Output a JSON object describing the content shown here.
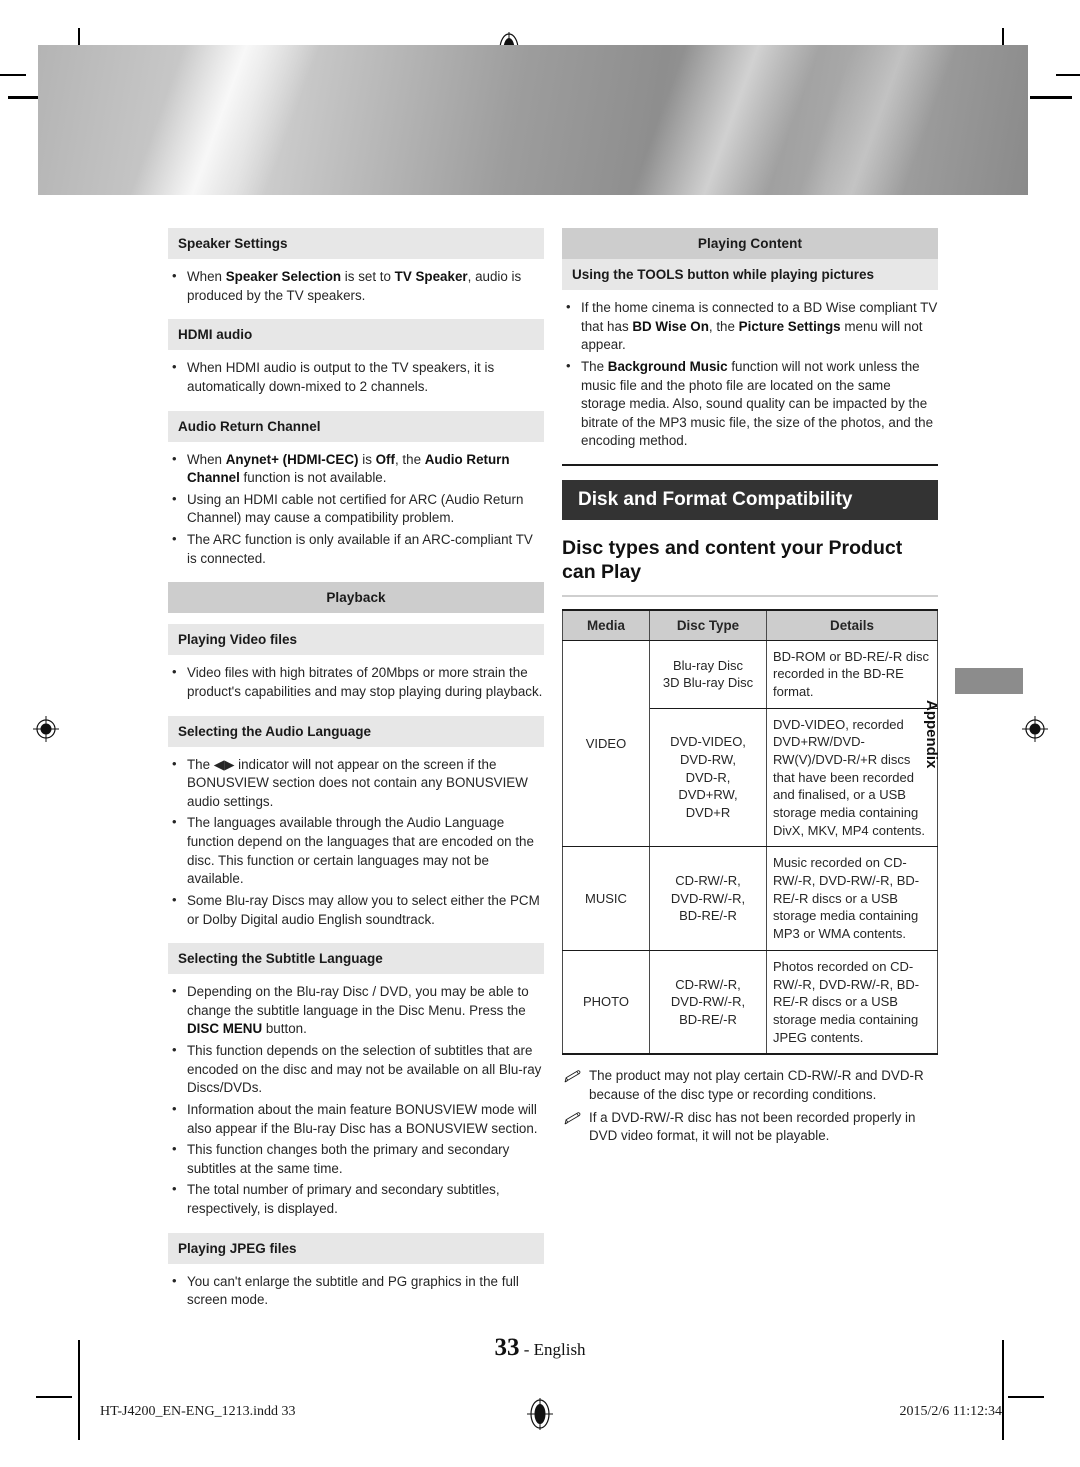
{
  "document": {
    "page_number": "33",
    "language": "English",
    "section_tab": "Appendix",
    "footer_file": "HT-J4200_EN-ENG_1213.indd   33",
    "footer_timestamp": "2015/2/6   11:12:34"
  },
  "colors": {
    "section_header_bg": "#cdcdcd",
    "sub_header_bg": "#e7e7e7",
    "dark_banner_bg": "#333333",
    "dark_banner_text": "#ffffff",
    "tab_bg": "#8c8c8c",
    "body_text": "#262626"
  },
  "left_column": {
    "blocks": [
      {
        "kind": "sub_header",
        "title": "Speaker Settings",
        "bullets": [
          [
            {
              "t": "When "
            },
            {
              "t": "Speaker Selection",
              "b": true
            },
            {
              "t": " is set to "
            },
            {
              "t": "TV Speaker",
              "b": true
            },
            {
              "t": ", audio is produced by the TV speakers."
            }
          ]
        ]
      },
      {
        "kind": "sub_header",
        "title": "HDMI audio",
        "bullets": [
          [
            {
              "t": "When HDMI audio is output to the TV speakers, it is automatically down-mixed to 2 channels."
            }
          ]
        ]
      },
      {
        "kind": "sub_header",
        "title": "Audio Return Channel",
        "bullets": [
          [
            {
              "t": "When "
            },
            {
              "t": "Anynet+ (HDMI-CEC)",
              "b": true
            },
            {
              "t": " is "
            },
            {
              "t": "Off",
              "b": true
            },
            {
              "t": ", the "
            },
            {
              "t": "Audio Return Channel",
              "b": true
            },
            {
              "t": " function is not available."
            }
          ],
          [
            {
              "t": "Using an HDMI cable not certified for ARC (Audio Return Channel) may cause a compatibility problem."
            }
          ],
          [
            {
              "t": "The ARC function is only available if an ARC-compliant TV is connected."
            }
          ]
        ]
      },
      {
        "kind": "section_header",
        "title": "Playback",
        "bullets": []
      },
      {
        "kind": "sub_header",
        "title": "Playing Video files",
        "bullets": [
          [
            {
              "t": "Video files with high bitrates of 20Mbps or more strain the product's capabilities and may stop playing during playback."
            }
          ]
        ]
      },
      {
        "kind": "sub_header",
        "title": "Selecting the Audio Language",
        "bullets": [
          [
            {
              "t": "The ◀▶ indicator will not appear on the screen if the BONUSVIEW section does not contain any BONUSVIEW audio settings."
            }
          ],
          [
            {
              "t": "The languages available through the Audio Language function depend on the languages that are encoded on the disc. This function or certain languages may not be available."
            }
          ],
          [
            {
              "t": "Some Blu-ray Discs may allow you to select either the PCM or Dolby Digital audio English soundtrack."
            }
          ]
        ]
      },
      {
        "kind": "sub_header",
        "title": "Selecting the Subtitle Language",
        "bullets": [
          [
            {
              "t": "Depending on the Blu-ray Disc / DVD, you may be able to change the subtitle language in the Disc Menu. Press the "
            },
            {
              "t": "DISC MENU",
              "b": true
            },
            {
              "t": " button."
            }
          ],
          [
            {
              "t": "This function depends on the selection of subtitles that are encoded on the disc and may not be available on all Blu-ray Discs/DVDs."
            }
          ],
          [
            {
              "t": "Information about the main feature BONUSVIEW mode will also appear if the Blu-ray Disc has a BONUSVIEW section."
            }
          ],
          [
            {
              "t": "This function changes both the primary and secondary subtitles at the same time."
            }
          ],
          [
            {
              "t": "The total number of primary and secondary subtitles, respectively, is displayed."
            }
          ]
        ]
      },
      {
        "kind": "sub_header",
        "title": "Playing JPEG files",
        "bullets": [
          [
            {
              "t": "You can't enlarge the subtitle and PG graphics in the full screen mode."
            }
          ]
        ]
      }
    ]
  },
  "right_column": {
    "playing_content": {
      "section_header": "Playing Content",
      "sub_header": "Using the TOOLS button while playing pictures",
      "bullets": [
        [
          {
            "t": "If the home cinema is connected to a BD Wise compliant TV that has "
          },
          {
            "t": "BD Wise On",
            "b": true
          },
          {
            "t": ", the "
          },
          {
            "t": "Picture Settings",
            "b": true
          },
          {
            "t": " menu will not appear."
          }
        ],
        [
          {
            "t": "The "
          },
          {
            "t": "Background Music",
            "b": true
          },
          {
            "t": " function will not work unless the music file and the photo file are located on the same storage media. Also, sound quality can be impacted by the bitrate of the MP3 music file, the size of the photos, and the encoding method."
          }
        ]
      ]
    },
    "chapter_banner": "Disk and Format Compatibility",
    "chapter_subtitle": "Disc types and content your Product can Play",
    "table": {
      "columns": [
        "Media",
        "Disc Type",
        "Details"
      ],
      "rows": [
        {
          "media": "VIDEO",
          "media_rowspan": 2,
          "disc_type": "Blu-ray Disc\n3D Blu-ray Disc",
          "details": "BD-ROM or BD-RE/-R disc recorded in the BD-RE format."
        },
        {
          "media": "",
          "disc_type": "DVD-VIDEO,\nDVD-RW,\nDVD-R,\nDVD+RW,\nDVD+R",
          "details": "DVD-VIDEO, recorded DVD+RW/DVD-RW(V)/DVD-R/+R discs that have been recorded and finalised, or a USB storage media containing DivX, MKV, MP4 contents."
        },
        {
          "media": "MUSIC",
          "disc_type": "CD-RW/-R,\nDVD-RW/-R,\nBD-RE/-R",
          "details": "Music recorded on CD-RW/-R, DVD-RW/-R, BD-RE/-R discs or a USB storage media containing MP3 or WMA contents."
        },
        {
          "media": "PHOTO",
          "disc_type": "CD-RW/-R,\nDVD-RW/-R,\nBD-RE/-R",
          "details": "Photos recorded on CD-RW/-R, DVD-RW/-R, BD-RE/-R discs or a USB storage media containing JPEG contents."
        }
      ]
    },
    "notes": [
      "The product may not play certain CD-RW/-R and DVD-R because of the disc type or recording conditions.",
      "If a DVD-RW/-R disc has not been recorded properly in DVD video format, it will not be playable."
    ]
  }
}
